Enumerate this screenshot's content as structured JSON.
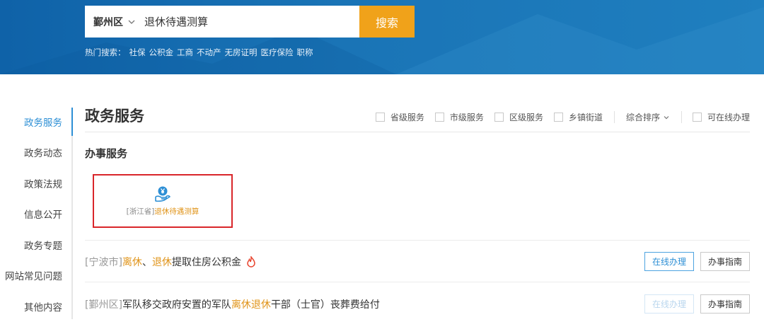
{
  "header": {
    "search": {
      "region": "鄞州区",
      "query": "退休待遇测算",
      "button_label": "搜索"
    },
    "hot_search": {
      "label": "热门搜索：",
      "items": [
        "社保",
        "公积金",
        "工商",
        "不动产",
        "无房证明",
        "医疗保险",
        "职称"
      ]
    }
  },
  "leftnav": {
    "items": [
      "政务服务",
      "政务动态",
      "政策法规",
      "信息公开",
      "政务专题",
      "网站常见问题",
      "其他内容"
    ],
    "active_index": 0
  },
  "main": {
    "title": "政务服务",
    "filters": [
      "省级服务",
      "市级服务",
      "区级服务",
      "乡镇街道"
    ],
    "sort_label": "综合排序",
    "online_filter": "可在线办理",
    "section_title": "办事服务",
    "card": {
      "province": "[浙江省]",
      "name": "退休待遇测算"
    },
    "rows": [
      {
        "location": "[宁波市]",
        "parts": [
          "离休",
          "、",
          "退休",
          "提取住房公积金"
        ],
        "online_label": "在线办理",
        "online_enabled": true,
        "guide_label": "办事指南"
      },
      {
        "location": "[鄞州区]",
        "parts": [
          "军队移交政府安置的军队",
          "离休退休",
          "干部（士官）丧葬费给付"
        ],
        "online_label": "在线办理",
        "online_enabled": false,
        "guide_label": "办事指南"
      }
    ]
  },
  "colors": {
    "header_blue": "#1a74b6",
    "search_button": "#f0a21a",
    "accent_blue": "#2d8fd5",
    "highlight_orange": "#e0941a",
    "card_border": "#d9262a"
  }
}
